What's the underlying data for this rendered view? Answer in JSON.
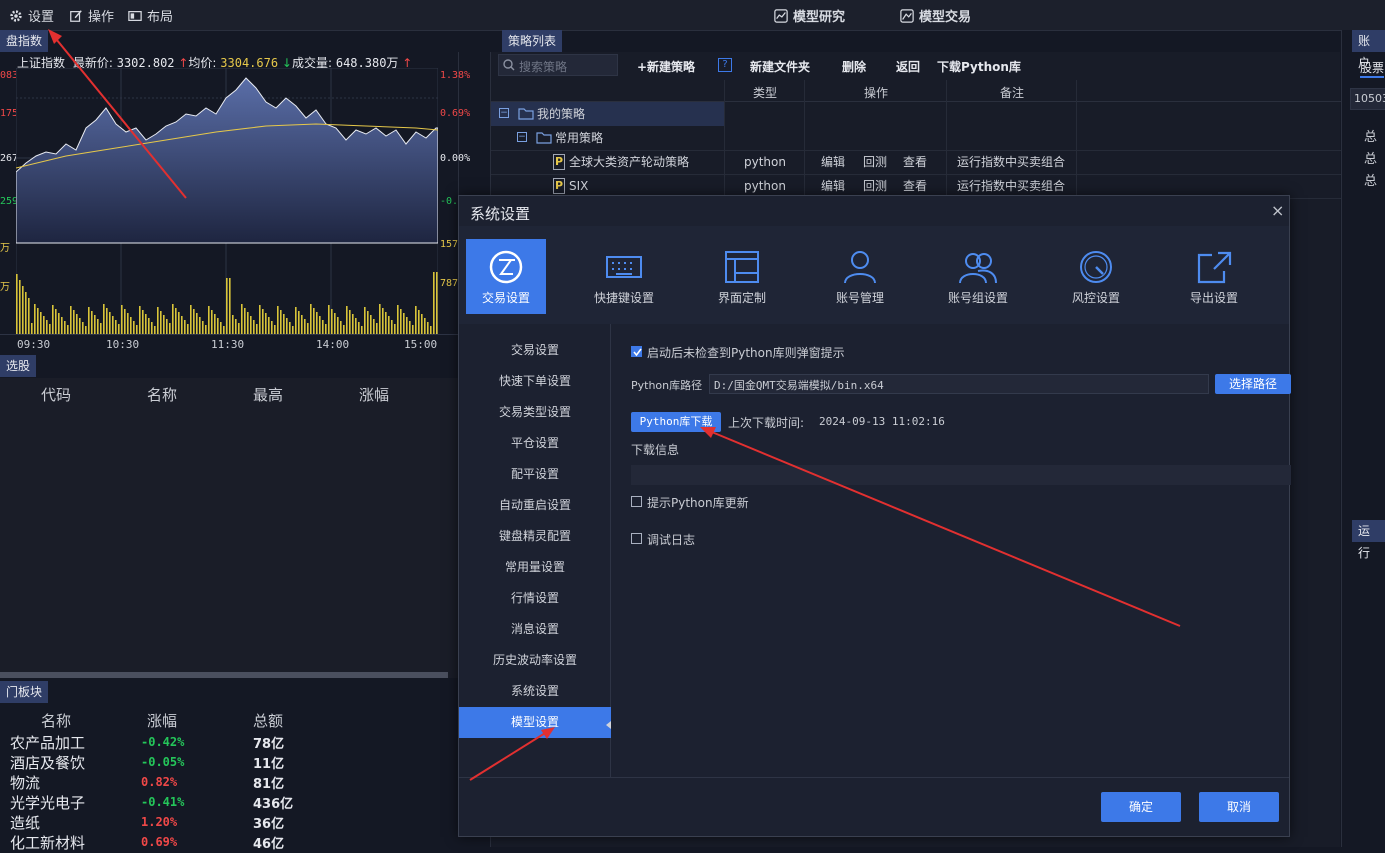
{
  "topbar": {
    "settings": "设置",
    "operate": "操作",
    "layout": "布局",
    "model_research": "模型研究",
    "model_trade": "模型交易"
  },
  "index_panel": {
    "tab": "盘指数",
    "name": "上证指数",
    "last_label": "最新价:",
    "last": "3302.802",
    "avg_label": "均价:",
    "avg": "3304.676",
    "vol_label": "成交量:",
    "vol": "648.380万",
    "left_ticks": [
      "083",
      "175",
      "267",
      "259"
    ],
    "right_ticks": [
      "1.38%",
      "0.69%",
      "0.00%",
      "-0."
    ],
    "vol_left_ticks": [
      "万",
      "万"
    ],
    "vol_right_ticks": [
      "157",
      "787"
    ],
    "time_ticks": [
      "09:30",
      "10:30",
      "11:30",
      "14:00",
      "15:00"
    ]
  },
  "select_panel": {
    "tab": "选股",
    "columns": [
      "代码",
      "名称",
      "最高",
      "涨幅"
    ]
  },
  "sector_panel": {
    "tab": "门板块",
    "columns": [
      "名称",
      "涨幅",
      "总额"
    ],
    "rows": [
      {
        "name": "农产品加工",
        "chg": "-0.42%",
        "amt": "78亿",
        "up": false
      },
      {
        "name": "酒店及餐饮",
        "chg": "-0.05%",
        "amt": "11亿",
        "up": false
      },
      {
        "name": "物流",
        "chg": "0.82%",
        "amt": "81亿",
        "up": true
      },
      {
        "name": "光学光电子",
        "chg": "-0.41%",
        "amt": "436亿",
        "up": false
      },
      {
        "name": "造纸",
        "chg": "1.20%",
        "amt": "36亿",
        "up": true
      },
      {
        "name": "化工新材料",
        "chg": "0.69%",
        "amt": "46亿",
        "up": true
      }
    ]
  },
  "strategy": {
    "tab": "策略列表",
    "search_placeholder": "搜索策略",
    "new_strategy": "+新建策略",
    "help": "?",
    "new_folder": "新建文件夹",
    "delete": "删除",
    "back": "返回",
    "download": "下载Python库",
    "columns": [
      "类型",
      "操作",
      "备注"
    ],
    "my_strategies": "我的策略",
    "common": "常用策略",
    "items": [
      {
        "name": "全球大类资产轮动策略",
        "type": "python",
        "edit": "编辑",
        "backtest": "回测",
        "view": "查看",
        "note": "运行指数中买卖组合"
      },
      {
        "name": "SIX",
        "type": "python",
        "edit": "编辑",
        "backtest": "回测",
        "view": "查看",
        "note": "运行指数中买卖组合"
      }
    ]
  },
  "right_panel": {
    "tab": "账户",
    "subtab": "股票",
    "account": "10503",
    "labels": [
      "总",
      "总",
      "总"
    ],
    "run_tab": "运行"
  },
  "dialog": {
    "title": "系统设置",
    "close": "×",
    "tiles": [
      "交易设置",
      "快捷键设置",
      "界面定制",
      "账号管理",
      "账号组设置",
      "风控设置",
      "导出设置"
    ],
    "side": [
      "交易设置",
      "快速下单设置",
      "交易类型设置",
      "平仓设置",
      "配平设置",
      "自动重启设置",
      "键盘精灵配置",
      "常用量设置",
      "行情设置",
      "消息设置",
      "历史波动率设置",
      "系统设置",
      "模型设置"
    ],
    "opt_popup": "启动后未检查到Python库则弹窗提示",
    "path_label": "Python库路径",
    "path_value": "D:/国金QMT交易端模拟/bin.x64",
    "choose_path": "选择路径",
    "download_btn": "Python库下载",
    "last_download_label": "上次下载时间:",
    "last_download": "2024-09-13 11:02:16",
    "download_info": "下载信息",
    "opt_update": "提示Python库更新",
    "opt_debug": "调试日志",
    "ok": "确定",
    "cancel": "取消"
  },
  "colors": {
    "accent": "#3d79e8",
    "up": "#f04848",
    "down": "#24c65a"
  }
}
